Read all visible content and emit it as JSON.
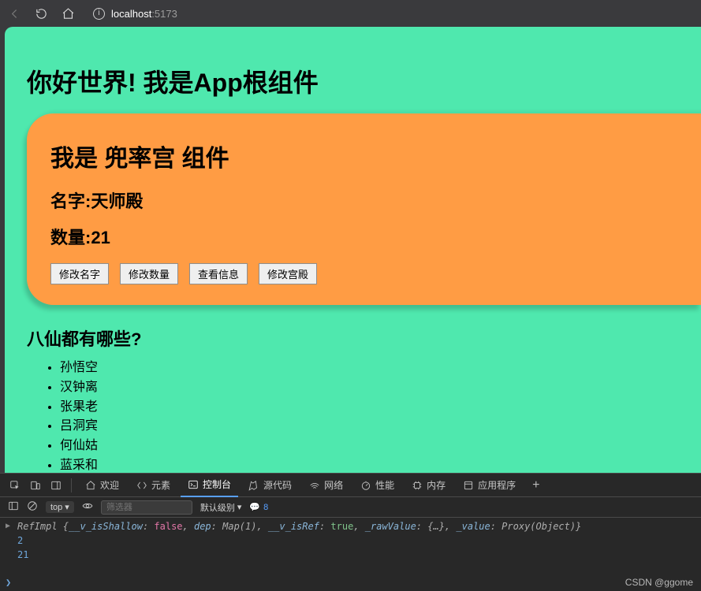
{
  "browser": {
    "url_host": "localhost",
    "url_port": ":5173"
  },
  "page": {
    "title": "你好世界! 我是App根组件",
    "card": {
      "title": "我是 兜率宫 组件",
      "name_label": "名字:",
      "name_value": "天师殿",
      "qty_label": "数量:",
      "qty_value": "21",
      "buttons": [
        "修改名字",
        "修改数量",
        "查看信息",
        "修改宫殿"
      ]
    },
    "list_title": "八仙都有哪些?",
    "list_items": [
      "孙悟空",
      "汉钟离",
      "张果老",
      "吕洞宾",
      "何仙姑",
      "蓝采和"
    ]
  },
  "devtools": {
    "tabs": [
      "欢迎",
      "元素",
      "控制台",
      "源代码",
      "网络",
      "性能",
      "内存",
      "应用程序"
    ],
    "active_tab": 2,
    "context": "top",
    "filter_placeholder": "筛选器",
    "level_label": "默认级别",
    "issues_count": "8",
    "console_lines": {
      "ref": "RefImpl {__v_isShallow: false, dep: Map(1), __v_isRef: true, _rawValue: {…}, _value: Proxy(Object)}",
      "l2": "2",
      "l3": "21"
    }
  },
  "watermark": "CSDN @ggome"
}
